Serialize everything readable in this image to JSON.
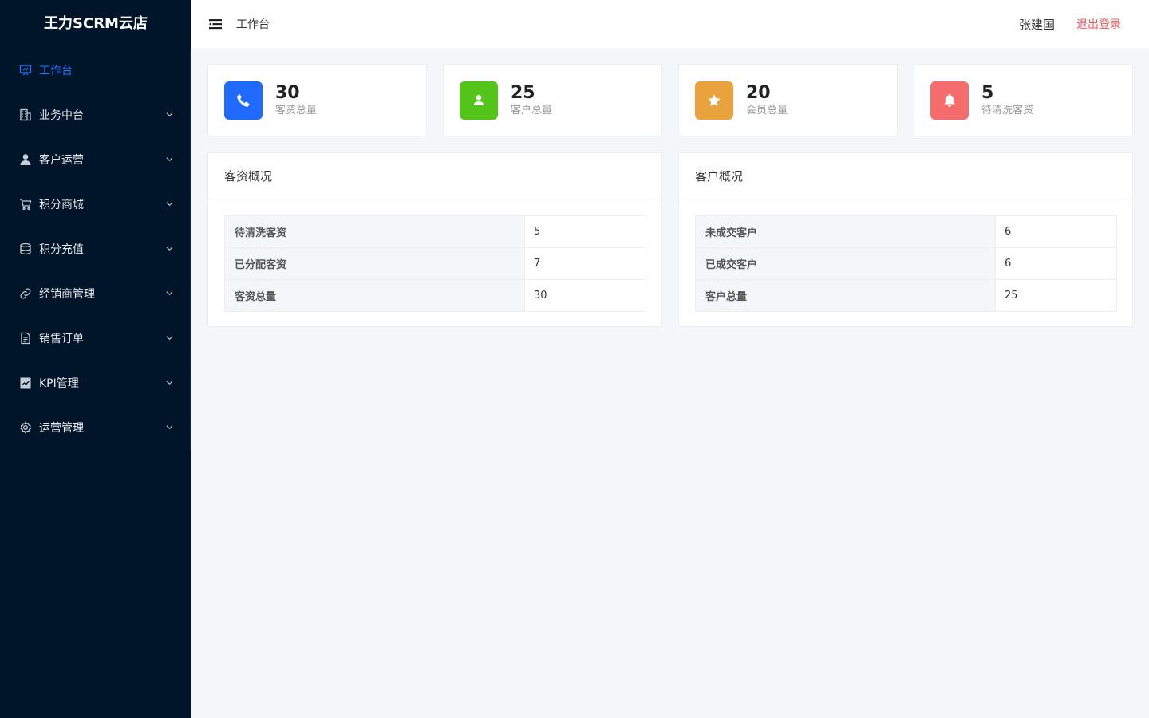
{
  "app": {
    "title": "王力SCRM云店"
  },
  "sidebar": {
    "items": [
      {
        "label": "工作台",
        "icon": "dashboard-icon",
        "active": true
      },
      {
        "label": "业务中台",
        "icon": "building-icon"
      },
      {
        "label": "客户运营",
        "icon": "user-icon"
      },
      {
        "label": "积分商城",
        "icon": "cart-icon"
      },
      {
        "label": "积分充值",
        "icon": "database-icon"
      },
      {
        "label": "经销商管理",
        "icon": "link-icon"
      },
      {
        "label": "销售订单",
        "icon": "document-icon"
      },
      {
        "label": "KPI管理",
        "icon": "chart-icon"
      },
      {
        "label": "运营管理",
        "icon": "gear-icon"
      }
    ]
  },
  "header": {
    "title": "工作台",
    "user": "张建国",
    "logout": "退出登录"
  },
  "stats": [
    {
      "value": "30",
      "label": "客资总量",
      "icon": "phone-icon",
      "color": "#1f6bff"
    },
    {
      "value": "25",
      "label": "客户总量",
      "icon": "user-icon",
      "color": "#52c41a"
    },
    {
      "value": "20",
      "label": "会员总量",
      "icon": "star-icon",
      "color": "#e8a33d"
    },
    {
      "value": "5",
      "label": "待清洗客资",
      "icon": "bell-icon",
      "color": "#f56c6c"
    }
  ],
  "panels": [
    {
      "title": "客资概况",
      "rows": [
        {
          "key": "待清洗客资",
          "value": "5"
        },
        {
          "key": "已分配客资",
          "value": "7"
        },
        {
          "key": "客资总量",
          "value": "30"
        }
      ]
    },
    {
      "title": "客户概况",
      "rows": [
        {
          "key": "未成交客户",
          "value": "6"
        },
        {
          "key": "已成交客户",
          "value": "6"
        },
        {
          "key": "客户总量",
          "value": "25"
        }
      ]
    }
  ]
}
